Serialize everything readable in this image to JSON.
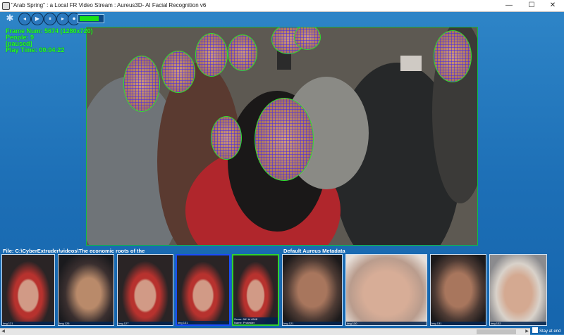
{
  "window": {
    "title": "\"Arab Spring\" : a Local FR Video Stream : Aureus3D- AI Facial Recognition v6",
    "minimize": "—",
    "maximize": "☐",
    "close": "✕"
  },
  "toolbar": {
    "buttons": [
      {
        "name": "settings",
        "glyph": "✱"
      },
      {
        "name": "step-back",
        "glyph": "◂"
      },
      {
        "name": "play",
        "glyph": "▶"
      },
      {
        "name": "pause",
        "glyph": "⏸"
      },
      {
        "name": "step-forward",
        "glyph": "▸"
      },
      {
        "name": "record",
        "glyph": "⏺"
      }
    ],
    "progress_fraction": 0.85,
    "progress_color": "#19e019"
  },
  "overlay": {
    "frame_num": "Frame Num: 5674 (1280x720)",
    "people": "People: 9",
    "status": "[paused]",
    "play_time": "Play Time: 00:04:22"
  },
  "video": {
    "face_outline_color": "#2fe02f",
    "mesh_color": "#4628e6"
  },
  "file_info": {
    "file_label": "File: C:\\CyberExtruder\\videos\\The economic roots of the",
    "metadata_label": "Default Aureus Metadata"
  },
  "thumbnails": [
    {
      "label": "Img 121",
      "style": "skin3"
    },
    {
      "label": "Img 126",
      "style": "skin2"
    },
    {
      "label": "Img 127",
      "style": "skin3"
    },
    {
      "label": "Img 131",
      "style": "skin3",
      "selected": "blue"
    },
    {
      "label": "Img 120",
      "label2": "Score: 96* id 4948",
      "label3": "Name: Protester",
      "style": "skin3",
      "selected": "green"
    },
    {
      "label": "Img 121",
      "style": "skin5"
    },
    {
      "label": "Img 130",
      "style": "skin6"
    },
    {
      "label": "Img 131",
      "style": "skin5"
    },
    {
      "label": "Img 132",
      "style": "skin4"
    }
  ],
  "stay_at_end": "Stay at end"
}
